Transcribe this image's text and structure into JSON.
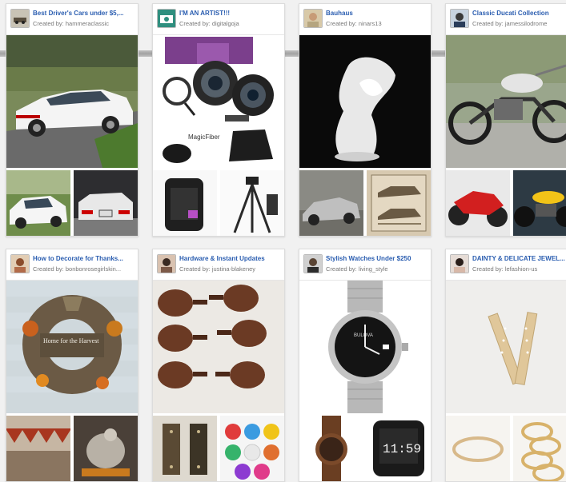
{
  "boards": [
    {
      "title": "Best Driver's Cars under $5,...",
      "creator": "Created by: hammeraclassic",
      "avatar_icon": "car-avatar-icon"
    },
    {
      "title": "I'M AN ARTIST!!!",
      "creator": "Created by: digitalgoja",
      "avatar_icon": "camera-avatar-icon"
    },
    {
      "title": "Bauhaus",
      "creator": "Created by: ninars13",
      "avatar_icon": "person-avatar-icon"
    },
    {
      "title": "Classic Ducati Collection",
      "creator": "Created by: jamessilodrome",
      "avatar_icon": "person-avatar-icon"
    },
    {
      "title": "How to Decorate for Thanks...",
      "creator": "Created by: bonbonrosegirlskin...",
      "avatar_icon": "person-avatar-icon"
    },
    {
      "title": "Hardware & Instant Updates",
      "creator": "Created by: justina-blakeney",
      "avatar_icon": "person-avatar-icon"
    },
    {
      "title": "Stylish Watches Under $250",
      "creator": "Created by: living_style",
      "avatar_icon": "person-avatar-icon"
    },
    {
      "title": "DAINTY & DELICATE JEWEL...",
      "creator": "Created by: lefashion-us",
      "avatar_icon": "person-avatar-icon"
    }
  ],
  "artwork": {
    "lens_brand": "MagicFiber",
    "wreath_sign": "Home for the Harvest",
    "watch_brand": "BULOVA",
    "digital_time": "11:59"
  },
  "colors": {
    "link_blue": "#2a5db0",
    "meta_gray": "#777777",
    "page_bg": "#f1f1f1"
  }
}
